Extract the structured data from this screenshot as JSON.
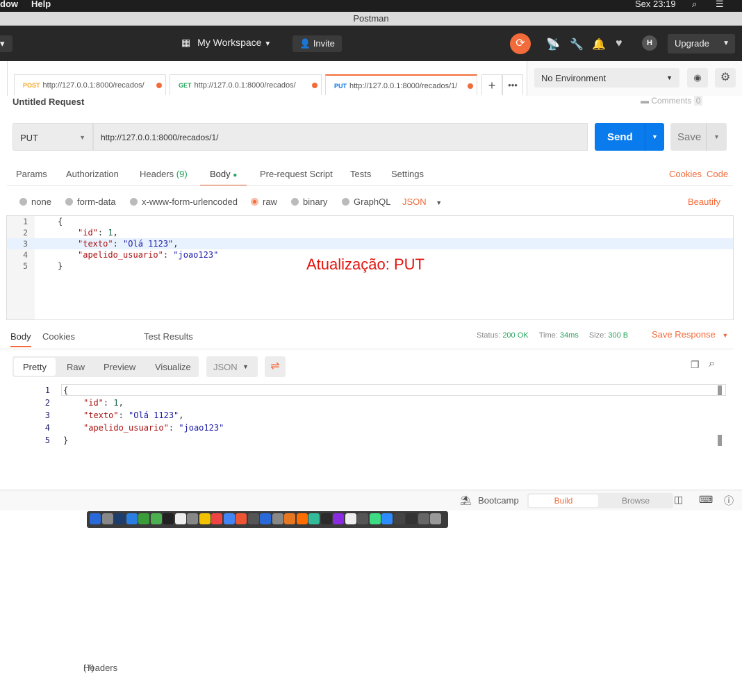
{
  "os_menu": {
    "items": [
      "dow",
      "Help"
    ],
    "clock": "Sex 23:19"
  },
  "window": {
    "title": "Postman"
  },
  "header": {
    "workspace": "My Workspace",
    "invite": "Invite",
    "upgrade": "Upgrade"
  },
  "request_tabs": [
    {
      "method": "POST",
      "url": "http://127.0.0.1:8000/recados/",
      "method_color": "#f5a623"
    },
    {
      "method": "GET",
      "url": "http://127.0.0.1:8000/recados/",
      "method_color": "#23a45a"
    },
    {
      "method": "PUT",
      "url": "http://127.0.0.1:8000/recados/1/",
      "method_color": "#097bed"
    }
  ],
  "environment": {
    "selected": "No Environment"
  },
  "request": {
    "name": "Untitled Request",
    "comments_label": "Comments",
    "comments_count": "0",
    "method": "PUT",
    "url": "http://127.0.0.1:8000/recados/1/",
    "send": "Send",
    "save": "Save"
  },
  "req_tabs": {
    "params": "Params",
    "authorization": "Authorization",
    "headers": "Headers",
    "headers_count": "(9)",
    "body": "Body",
    "prerequest": "Pre-request Script",
    "tests": "Tests",
    "settings": "Settings",
    "cookies": "Cookies",
    "code": "Code"
  },
  "body_types": {
    "none": "none",
    "form_data": "form-data",
    "urlencoded": "x-www-form-urlencoded",
    "raw": "raw",
    "binary": "binary",
    "graphql": "GraphQL",
    "format": "JSON",
    "beautify": "Beautify"
  },
  "request_body": {
    "lines": [
      "1",
      "2",
      "3",
      "4",
      "5"
    ],
    "open": "{",
    "k1": "\"id\"",
    "v1": "1",
    "k2": "\"texto\"",
    "v2": "\"Olá 1123\"",
    "k3": "\"apelido_usuario\"",
    "v3": "\"joao123\"",
    "close": "}"
  },
  "annotation": "Atualização: PUT",
  "response": {
    "tabs": {
      "body": "Body",
      "cookies": "Cookies",
      "headers": "Headers",
      "headers_count": "(7)",
      "tests": "Test Results"
    },
    "status_label": "Status:",
    "status": "200 OK",
    "time_label": "Time:",
    "time": "34ms",
    "size_label": "Size:",
    "size": "300 B",
    "save_response": "Save Response",
    "views": {
      "pretty": "Pretty",
      "raw": "Raw",
      "preview": "Preview",
      "visualize": "Visualize"
    },
    "format": "JSON"
  },
  "footer": {
    "bootcamp": "Bootcamp",
    "build": "Build",
    "browse": "Browse"
  }
}
